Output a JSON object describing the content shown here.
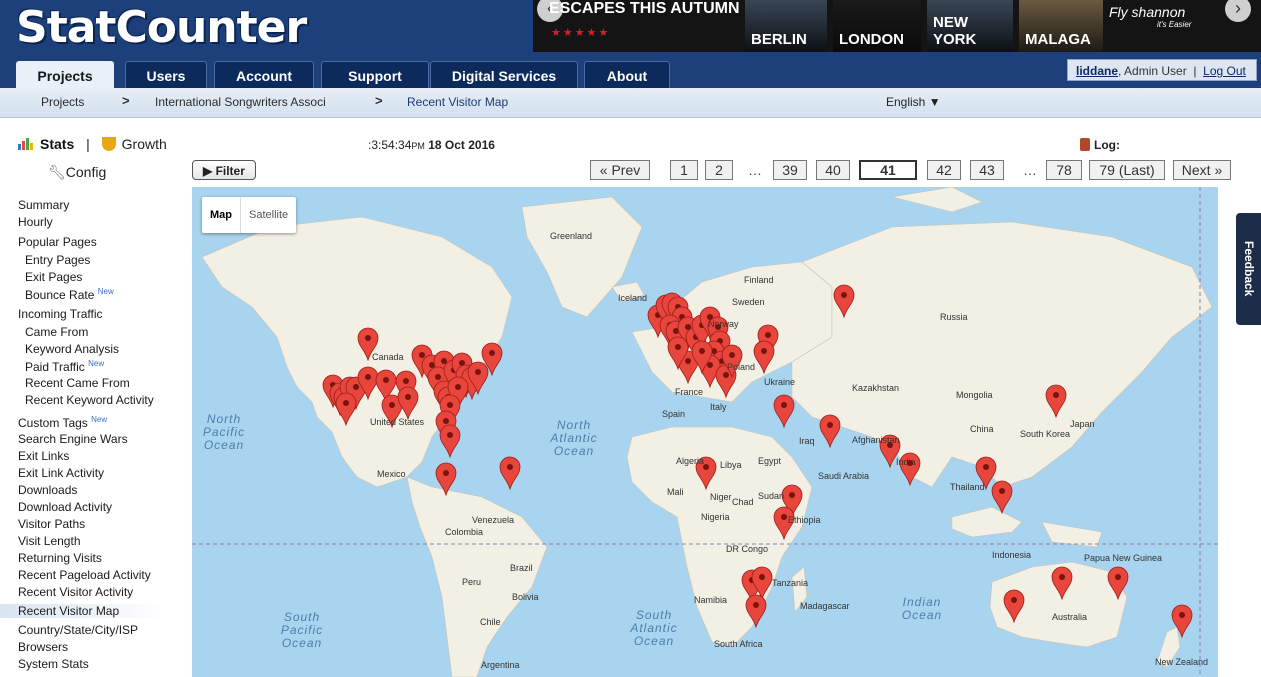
{
  "brand": {
    "logo": "StatCounter"
  },
  "ad": {
    "headline": "ESCAPES THIS AUTUMN",
    "stars": "★★★★★",
    "cities": [
      "BERLIN",
      "LONDON",
      "NEW YORK",
      "MALAGA"
    ],
    "brand_name": "Fly shannon",
    "brand_tag": "it's Easier"
  },
  "tabs": [
    "Projects",
    "Users",
    "Account",
    "Support",
    "Digital Services",
    "About"
  ],
  "user": {
    "name": "liddane",
    "role": ", Admin User",
    "logout": "Log Out"
  },
  "breadcrumb": {
    "items": [
      "Projects",
      "International Songwriters Associ",
      "Recent Visitor Map"
    ],
    "separator": ">",
    "language": "English ▼"
  },
  "sidebar": {
    "stats": "Stats",
    "divider": "|",
    "growth": "Growth",
    "config": "Config",
    "items": [
      {
        "label": "Summary",
        "sub": false
      },
      {
        "label": "Hourly",
        "sub": false
      },
      {
        "label": "Popular Pages",
        "sub": false
      },
      {
        "label": "Entry Pages",
        "sub": true
      },
      {
        "label": "Exit Pages",
        "sub": true
      },
      {
        "label": "Bounce Rate",
        "sub": true,
        "badge": "New"
      },
      {
        "label": "Incoming Traffic",
        "sub": false
      },
      {
        "label": "Came From",
        "sub": true
      },
      {
        "label": "Keyword Analysis",
        "sub": true
      },
      {
        "label": "Paid Traffic",
        "sub": true,
        "badge": "New"
      },
      {
        "label": "Recent Came From",
        "sub": true
      },
      {
        "label": "Recent Keyword Activity",
        "sub": true
      },
      {
        "label": "Custom Tags",
        "sub": false,
        "badge": "New"
      },
      {
        "label": "Search Engine Wars",
        "sub": false
      },
      {
        "label": "Exit Links",
        "sub": false
      },
      {
        "label": "Exit Link Activity",
        "sub": false
      },
      {
        "label": "Downloads",
        "sub": false
      },
      {
        "label": "Download Activity",
        "sub": false
      },
      {
        "label": "Visitor Paths",
        "sub": false
      },
      {
        "label": "Visit Length",
        "sub": false
      },
      {
        "label": "Returning Visits",
        "sub": false
      },
      {
        "label": "Recent Pageload Activity",
        "sub": false
      },
      {
        "label": "Recent Visitor Activity",
        "sub": false
      },
      {
        "label": "Recent Visitor Map",
        "sub": false,
        "active": true
      },
      {
        "label": "Country/State/City/ISP",
        "sub": false
      },
      {
        "label": "Browsers",
        "sub": false
      },
      {
        "label": "System Stats",
        "sub": false
      }
    ]
  },
  "log": {
    "time": ":3:54:34",
    "ampm": "PM",
    "date": "18 Oct 2016",
    "label": "Log:"
  },
  "filter": "Filter",
  "pagination": {
    "prev": "« Prev",
    "pages": [
      "1",
      "2",
      "…",
      "39",
      "40",
      "41",
      "42",
      "43",
      "…",
      "78",
      "79 (Last)"
    ],
    "current": "41",
    "next": "Next »"
  },
  "map": {
    "toggle": [
      "Map",
      "Satellite"
    ],
    "countries": [
      "Greenland",
      "Iceland",
      "Finland",
      "Sweden",
      "Norway",
      "Russia",
      "Canada",
      "United States",
      "Mexico",
      "Spain",
      "France",
      "Italy",
      "Poland",
      "Ukraine",
      "Kazakhstan",
      "Mongolia",
      "China",
      "South Korea",
      "Japan",
      "Iraq",
      "Afghanistan",
      "Saudi Arabia",
      "Egypt",
      "Libya",
      "Algeria",
      "Mali",
      "Niger",
      "Chad",
      "Sudan",
      "Nigeria",
      "Ethiopia",
      "DR Congo",
      "Tanzania",
      "Namibia",
      "South Africa",
      "Madagascar",
      "Venezuela",
      "Colombia",
      "Brazil",
      "Peru",
      "Bolivia",
      "Chile",
      "Argentina",
      "Thailand",
      "Indonesia",
      "Papua New Guinea",
      "Australia",
      "New Zealand",
      "India"
    ],
    "oceans": [
      "North Pacific Ocean",
      "North Atlantic Ocean",
      "South Pacific Ocean",
      "South Atlantic Ocean",
      "Indian Ocean"
    ]
  },
  "feedback": "Feedback",
  "colors": {
    "header": "#1d3f7a",
    "tab": "#0c2a5c",
    "ocean": "#a8d4ef",
    "land": "#f2efe4",
    "marker": "#e8453c"
  }
}
